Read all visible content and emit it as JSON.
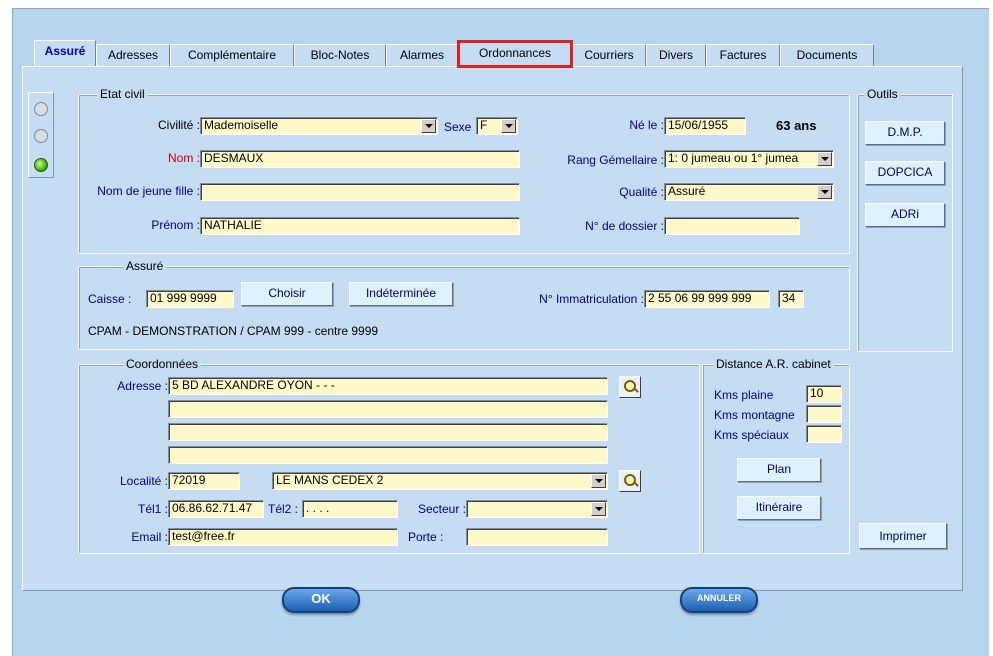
{
  "tabs": [
    {
      "label": "Assuré",
      "active": true
    },
    {
      "label": "Adresses"
    },
    {
      "label": "Complémentaire"
    },
    {
      "label": "Bloc-Notes"
    },
    {
      "label": "Alarmes"
    },
    {
      "label": "Ordonnances",
      "highlighted": true
    },
    {
      "label": "Courriers"
    },
    {
      "label": "Divers"
    },
    {
      "label": "Factures"
    },
    {
      "label": "Documents"
    }
  ],
  "etat_civil": {
    "legend": "Etat civil",
    "civilite_label": "Civilité :",
    "civilite_value": "Mademoiselle",
    "sexe_label": "Sexe",
    "sexe_value": "F",
    "nom_label": "Nom :",
    "nom_value": "DESMAUX",
    "jeune_fille_label": "Nom  de jeune fille :",
    "jeune_fille_value": "",
    "prenom_label": "Prénom :",
    "prenom_value": "NATHALIE",
    "ne_le_label": "Né le :",
    "ne_le_value": "15/06/1955",
    "age": "63 ans",
    "rang_label": "Rang Gémellaire :",
    "rang_value": "1: 0 jumeau ou 1° jumea",
    "qualite_label": "Qualité :",
    "qualite_value": "Assuré",
    "dossier_label": "N° de dossier :",
    "dossier_value": ""
  },
  "outils": {
    "legend": "Outils",
    "buttons": [
      "D.M.P.",
      "DOPCICA",
      "ADRi"
    ],
    "imprimer": "Imprimer"
  },
  "assure": {
    "legend": "Assuré",
    "caisse_label": "Caisse :",
    "caisse_value": "01 999 9999",
    "choisir": "Choisir",
    "indeterminee": "Indéterminée",
    "immat_label": "N° Immatriculation :",
    "immat_value": "2 55 06 99 999 999",
    "immat_key": "34",
    "caisse_name": "CPAM - DEMONSTRATION / CPAM 999 - centre 9999"
  },
  "coordonnees": {
    "legend": "Coordonnées",
    "adresse_label": "Adresse :",
    "adresse_lines": [
      "5 BD ALEXANDRE OYON - - -",
      "",
      "",
      ""
    ],
    "localite_label": "Localité :",
    "cp_value": "72019",
    "ville_value": "LE MANS CEDEX 2",
    "tel1_label": "Tél1 :",
    "tel1_value": "06.86.62.71.47",
    "tel2_label": "Tél2 :",
    "tel2_value": "  .  .  .  .",
    "secteur_label": "Secteur :",
    "secteur_value": "",
    "email_label": "Email :",
    "email_value": "test@free.fr",
    "porte_label": "Porte :",
    "porte_value": ""
  },
  "distance": {
    "legend": "Distance A.R. cabinet",
    "plaine_label": "Kms plaine",
    "plaine_value": "10",
    "montagne_label": "Kms montagne",
    "montagne_value": "",
    "speciaux_label": "Kms spéciaux",
    "speciaux_value": "",
    "plan": "Plan",
    "itineraire": "Itinéraire"
  },
  "footer": {
    "ok": "OK",
    "annuler": "ANNULER"
  },
  "colors": {
    "window": "#b7d4ee",
    "panel": "#c5dcf2",
    "field": "#fff8c8",
    "highlight": "#e02020",
    "nom_label": "#d00000"
  }
}
